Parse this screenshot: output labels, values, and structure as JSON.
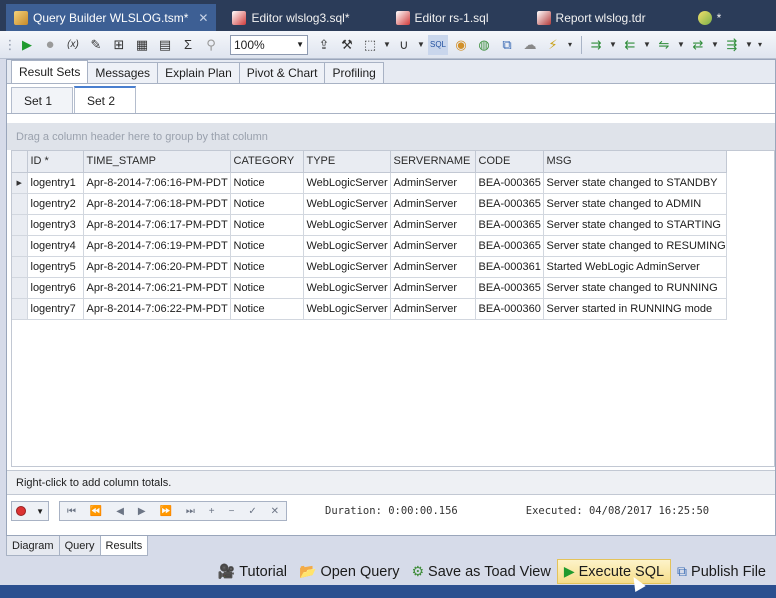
{
  "document_tabs": [
    {
      "label": "Query Builder WLSLOG.tsm*",
      "icon": "query-builder-icon",
      "active": true
    },
    {
      "label": "Editor wlslog3.sql*",
      "icon": "sql-editor-icon",
      "active": false
    },
    {
      "label": "Editor rs-1.sql",
      "icon": "sql-editor-icon",
      "active": false
    },
    {
      "label": "Report wlslog.tdr",
      "icon": "report-icon",
      "active": false
    },
    {
      "label": "*",
      "icon": "automation-icon",
      "active": false
    }
  ],
  "toolbar": {
    "zoom": "100%"
  },
  "result_tabs": [
    "Result Sets",
    "Messages",
    "Explain Plan",
    "Pivot & Chart",
    "Profiling"
  ],
  "set_tabs": [
    "Set 1",
    "Set 2"
  ],
  "group_hint": "Drag a column header here to group by that column",
  "grid": {
    "columns": [
      "ID *",
      "TIME_STAMP",
      "CATEGORY",
      "TYPE",
      "SERVERNAME",
      "CODE",
      "MSG"
    ],
    "rows": [
      [
        "logentry1",
        "Apr-8-2014-7:06:16-PM-PDT",
        "Notice",
        "WebLogicServer",
        "AdminServer",
        "BEA-000365",
        "Server state changed to STANDBY"
      ],
      [
        "logentry2",
        "Apr-8-2014-7:06:18-PM-PDT",
        "Notice",
        "WebLogicServer",
        "AdminServer",
        "BEA-000365",
        "Server state changed to ADMIN"
      ],
      [
        "logentry3",
        "Apr-8-2014-7:06:17-PM-PDT",
        "Notice",
        "WebLogicServer",
        "AdminServer",
        "BEA-000365",
        "Server state changed to STARTING"
      ],
      [
        "logentry4",
        "Apr-8-2014-7:06:19-PM-PDT",
        "Notice",
        "WebLogicServer",
        "AdminServer",
        "BEA-000365",
        "Server state changed to RESUMING"
      ],
      [
        "logentry5",
        "Apr-8-2014-7:06:20-PM-PDT",
        "Notice",
        "WebLogicServer",
        "AdminServer",
        "BEA-000361",
        "Started WebLogic AdminServer"
      ],
      [
        "logentry6",
        "Apr-8-2014-7:06:21-PM-PDT",
        "Notice",
        "WebLogicServer",
        "AdminServer",
        "BEA-000365",
        "Server state changed to RUNNING"
      ],
      [
        "logentry7",
        "Apr-8-2014-7:06:22-PM-PDT",
        "Notice",
        "WebLogicServer",
        "AdminServer",
        "BEA-000360",
        "Server started in RUNNING mode"
      ]
    ]
  },
  "footer_note": "Right-click to add column totals.",
  "status": {
    "duration": "Duration: 0:00:00.156",
    "executed": "Executed: 04/08/2017 16:25:50"
  },
  "bottom_tabs": [
    "Diagram",
    "Query",
    "Results"
  ],
  "actions": [
    {
      "label": "Tutorial",
      "icon": "film-camera-icon"
    },
    {
      "label": "Open Query",
      "icon": "open-folder-icon"
    },
    {
      "label": "Save as Toad View",
      "icon": "toad-view-icon"
    },
    {
      "label": "Execute SQL",
      "icon": "play-icon"
    },
    {
      "label": "Publish File",
      "icon": "publish-file-icon"
    }
  ]
}
